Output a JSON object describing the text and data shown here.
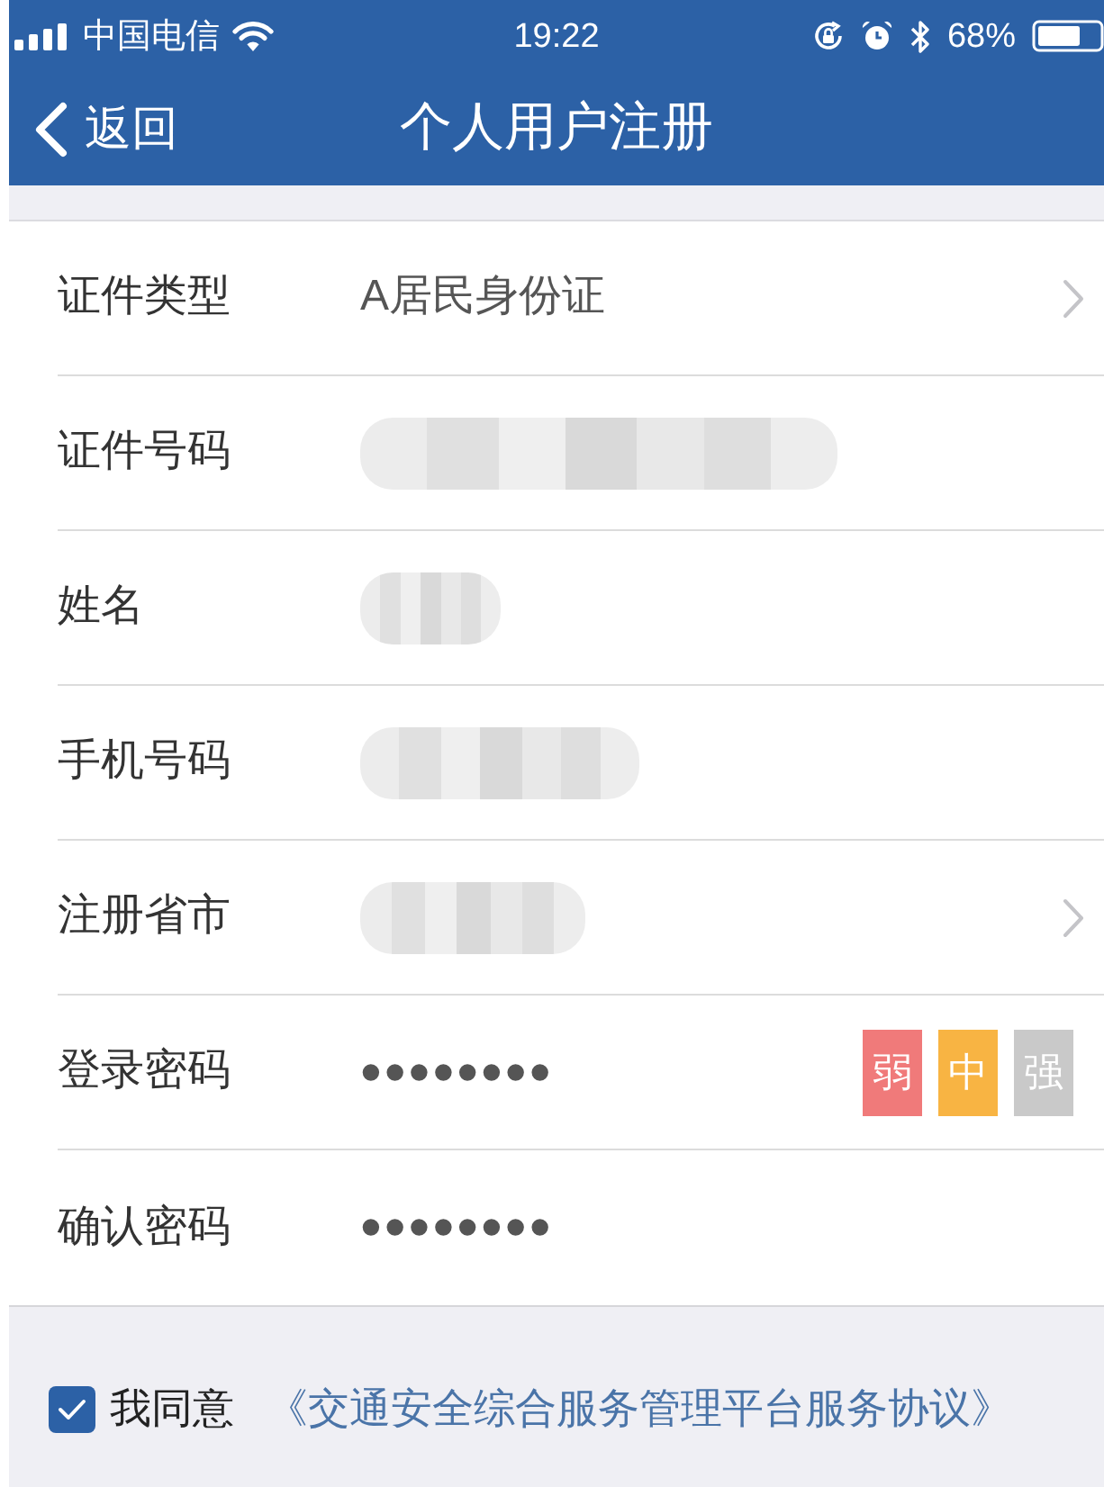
{
  "status_bar": {
    "carrier": "中国电信",
    "time": "19:22",
    "battery": "68%"
  },
  "nav_bar": {
    "back": "返回",
    "title": "个人用户注册"
  },
  "form": {
    "rows": [
      {
        "label": "证件类型",
        "kind": "select",
        "blurred": false,
        "value": "A居民身份证"
      },
      {
        "label": "证件号码",
        "kind": "text",
        "blurred": true
      },
      {
        "label": "姓名",
        "kind": "text",
        "blurred": true
      },
      {
        "label": "手机号码",
        "kind": "text",
        "blurred": true
      },
      {
        "label": "注册省市",
        "kind": "select",
        "blurred": true
      },
      {
        "label": "登录密码",
        "kind": "password",
        "blurred": false,
        "value": "••••••••",
        "strength": [
          {
            "label": "弱",
            "color": "#f07a7a"
          },
          {
            "label": "中",
            "color": "#f8b443"
          },
          {
            "label": "强",
            "color": "#c9c9c9"
          }
        ]
      },
      {
        "label": "确认密码",
        "kind": "password",
        "blurred": false,
        "value": "••••••••"
      }
    ]
  },
  "agreement": {
    "checked": true,
    "label": "我同意",
    "link": "《交通安全综合服务管理平台服务协议》"
  }
}
